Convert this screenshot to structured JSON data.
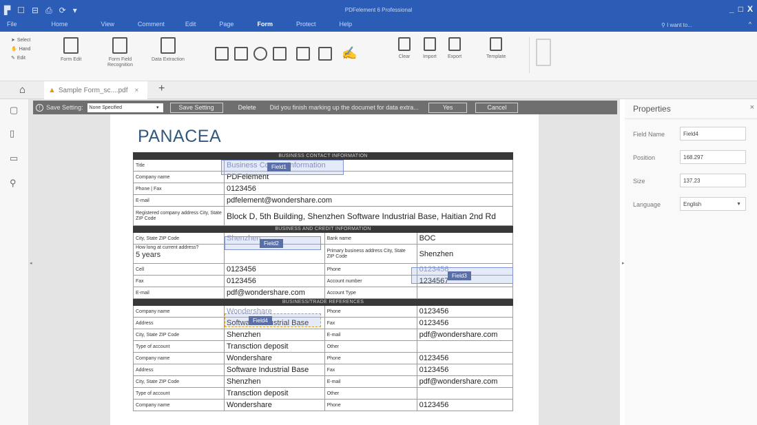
{
  "app": {
    "title": "PDFelement 6 Professional",
    "iwant": "I want to...",
    "collapse_glyph": "^",
    "window_controls": [
      "_",
      "□",
      "X"
    ]
  },
  "menu": [
    "File",
    "Home",
    "View",
    "Comment",
    "Edit",
    "Page",
    "Form",
    "Protect",
    "Help"
  ],
  "menu_active": "Form",
  "ribbon": {
    "select": "Select",
    "hand": "Hand",
    "edit": "Edit",
    "form_edit": "Form Edit",
    "form_field": "Form Field",
    "recognition": "Recognition",
    "data_extraction": "Data Extraction",
    "clear": "Clear",
    "import": "Import",
    "export": "Export",
    "template": "Template"
  },
  "tab": {
    "title": "Sample Form_sc....pdf",
    "close": "×",
    "add": "+"
  },
  "extraction_bar": {
    "label": "Save Setting:",
    "select_value": "None Specified",
    "save_setting": "Save Setting",
    "delete": "Delete",
    "message": "Did you finish marking up the documet for data extra...",
    "yes": "Yes",
    "cancel": "Cancel"
  },
  "document": {
    "heading": "PANACEA",
    "sections": {
      "contact": "BUSINESS CONTACT INFORMATION",
      "credit": "BUSINESS AND CREDIT INFORMATION",
      "references": "BUSINESS/TRADE REFERENCES"
    },
    "contact_rows": [
      {
        "label": "Title",
        "value": "Business Contact Information"
      },
      {
        "label": "Company name",
        "value": "PDFelement"
      },
      {
        "label": "Phone | Fax",
        "value": "0123456"
      },
      {
        "label": "E-mail",
        "value": "pdfelement@wondershare.com"
      },
      {
        "label": "Registered company address City, State ZIP Code",
        "value": "Block D, 5th Building, Shenzhen Software Industrial Base, Haitian 2nd Rd"
      }
    ],
    "credit_rows": [
      {
        "l1": "City, State ZIP Code",
        "v1": "Shenzhen",
        "l2": "Bank name",
        "v2": "BOC"
      },
      {
        "l1": "How long at current address?",
        "v1": "5 years",
        "l2": "Primary business address City, State ZIP Code",
        "v2": "Shenzhen"
      },
      {
        "l1": "Cell",
        "v1": "0123456",
        "l2": "Phone",
        "v2": "0123456"
      },
      {
        "l1": "Fax",
        "v1": "0123456",
        "l2": "Account number",
        "v2": "1234567"
      },
      {
        "l1": "E-mail",
        "v1": "pdf@wondershare.com",
        "l2": "Account Type",
        "v2": ""
      }
    ],
    "reference_rows": [
      {
        "l1": "Company name",
        "v1": "Wondershare",
        "l2": "Phone",
        "v2": "0123456"
      },
      {
        "l1": "Address",
        "v1": "Software Industrial Base",
        "l2": "Fax",
        "v2": "0123456"
      },
      {
        "l1": "City, State ZIP Code",
        "v1": "Shenzhen",
        "l2": "E-mail",
        "v2": "pdf@wondershare.com"
      },
      {
        "l1": "Type of account",
        "v1": "Transction deposit",
        "l2": "Other",
        "v2": ""
      },
      {
        "l1": "Company name",
        "v1": "Wondershare",
        "l2": "Phone",
        "v2": "0123456"
      },
      {
        "l1": "Address",
        "v1": "Software Industrial Base",
        "l2": "Fax",
        "v2": "0123456"
      },
      {
        "l1": "City, State ZIP Code",
        "v1": "Shenzhen",
        "l2": "E-mail",
        "v2": "pdf@wondershare.com"
      },
      {
        "l1": "Type of account",
        "v1": "Transction deposit",
        "l2": "Other",
        "v2": ""
      },
      {
        "l1": "Company name",
        "v1": "Wondershare",
        "l2": "Phone",
        "v2": "0123456"
      }
    ]
  },
  "fields": [
    "Field1",
    "Field2",
    "Field3",
    "Field4"
  ],
  "properties": {
    "title": "Properties",
    "close": "×",
    "field_name_label": "Field Name",
    "field_name_value": "Field4",
    "position_label": "Position",
    "position_value": "168.297",
    "size_label": "Size",
    "size_value": "137.23",
    "language_label": "Language",
    "language_value": "English"
  },
  "colors": {
    "titlebar": "#2c5db6",
    "extract_bar": "#6f6f6f",
    "heading": "#34597e",
    "field_tag": "#5a6fa8"
  }
}
